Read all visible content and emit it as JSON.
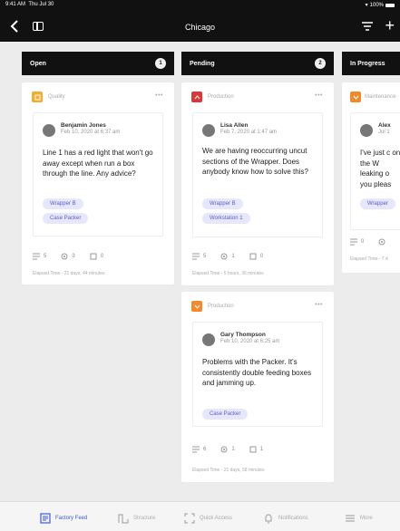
{
  "status_bar": {
    "time": "9:41 AM",
    "day": "Thu Jul 30",
    "battery": "100%"
  },
  "nav": {
    "title": "Chicago"
  },
  "columns": [
    {
      "title": "Open",
      "count": "1"
    },
    {
      "title": "Pending",
      "count": "2"
    },
    {
      "title": "In Progress",
      "count": ""
    }
  ],
  "cards": [
    {
      "category": "Quality",
      "category_color": "#f0ad2e",
      "author": "Benjamin Jones",
      "date": "Feb 10, 2020 at 6:37 am",
      "text": "Line 1 has a red light that won't go away except when run a box through the line. Any advice?",
      "tags": [
        "Wrapper B",
        "Case Packer"
      ],
      "comments": "5",
      "views": "3",
      "attachments": "0",
      "elapsed": "Elapsed Time - 21 days, 44 minutes"
    },
    {
      "category": "Production",
      "category_color": "#d9383a",
      "author": "Lisa Allen",
      "date": "Feb 7, 2020 at 1:47 am",
      "text": "We are having reoccurring uncut sections of the Wrapper. Does anybody know how to solve this?",
      "tags": [
        "Wrapper B",
        "Workstation 1"
      ],
      "comments": "5",
      "views": "1",
      "attachments": "0",
      "elapsed": "Elapsed Time - 5 hours, 36 minutes"
    },
    {
      "category": "Production",
      "category_color": "#f08a2c",
      "author": "Gary Thompson",
      "date": "Feb 10, 2020 at 6:25 am",
      "text": "Problems with the Packer. It's consistently double feeding boxes and jamming up.",
      "tags": [
        "Case Packer"
      ],
      "comments": "6",
      "views": "1",
      "attachments": "1",
      "elapsed": "Elapsed Time - 21 days, 58 minutes"
    },
    {
      "category": "Maintenance",
      "category_color": "#f08a2c",
      "author": "Alex",
      "date": "Jul 1",
      "text": "I've just c on the W leaking o you pleas",
      "tags": [
        "Wrapper"
      ],
      "comments": "0",
      "views": "",
      "elapsed": "Elapsed Time - 7 d"
    }
  ],
  "tabbar": [
    {
      "label": "Factory Feed",
      "icon": "factory-feed-icon",
      "active": true
    },
    {
      "label": "Structure",
      "icon": "structure-icon"
    },
    {
      "label": "Quick Access",
      "icon": "quick-access-icon"
    },
    {
      "label": "Notifications",
      "icon": "bell-icon"
    },
    {
      "label": "More",
      "icon": "menu-icon"
    }
  ]
}
